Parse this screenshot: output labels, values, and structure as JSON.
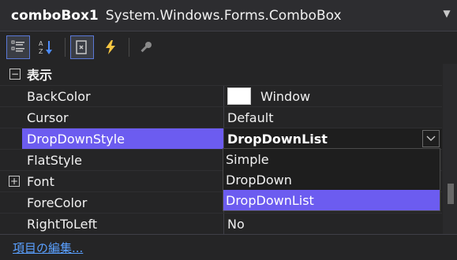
{
  "header": {
    "object_name": "comboBox1",
    "object_type": "System.Windows.Forms.ComboBox"
  },
  "toolbar": {
    "buttons": [
      {
        "icon": "categorized-icon",
        "active": true
      },
      {
        "icon": "alphabetical-icon",
        "active": false
      },
      {
        "icon": "properties-icon",
        "active": true
      },
      {
        "icon": "events-icon",
        "active": false
      },
      {
        "icon": "property-pages-icon",
        "active": false
      }
    ]
  },
  "grid": {
    "category": "表示",
    "rows": [
      {
        "name": "BackColor",
        "value": "Window",
        "swatch": "#ffffff"
      },
      {
        "name": "Cursor",
        "value": "Default"
      },
      {
        "name": "DropDownStyle",
        "value": "DropDownList",
        "selected": true
      },
      {
        "name": "FlatStyle",
        "value": ""
      },
      {
        "name": "Font",
        "value": "",
        "expandable": true
      },
      {
        "name": "ForeColor",
        "value": ""
      },
      {
        "name": "RightToLeft",
        "value": "No"
      }
    ]
  },
  "dropdown": {
    "options": [
      "Simple",
      "DropDown",
      "DropDownList"
    ],
    "selected": "DropDownList"
  },
  "footer": {
    "link": "項目の編集..."
  },
  "colors": {
    "background": "#252526",
    "selection": "#6c5cf0",
    "link": "#5aa0ff"
  }
}
